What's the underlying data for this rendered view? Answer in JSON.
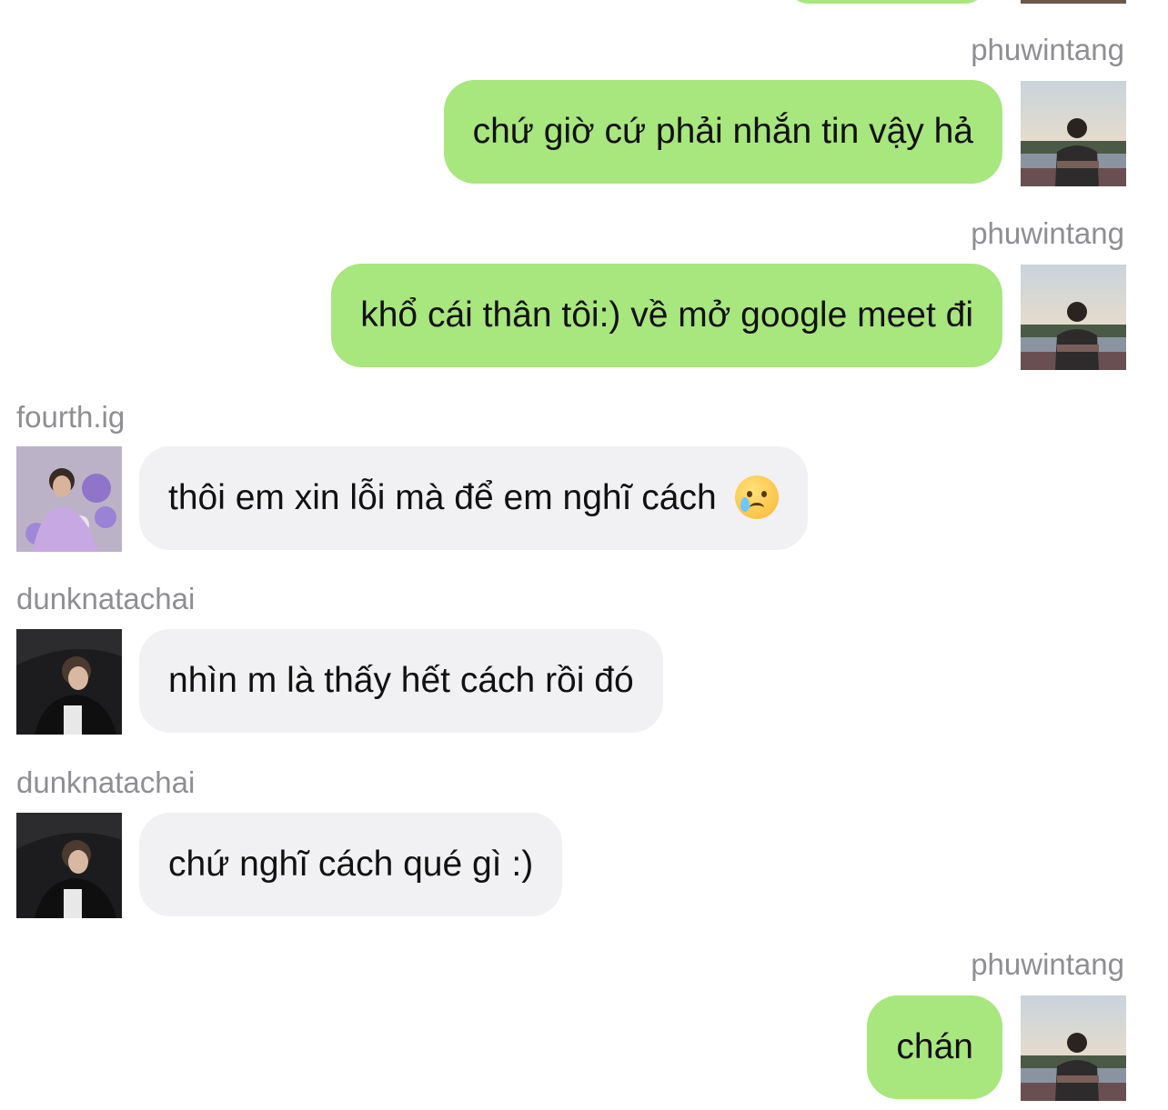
{
  "messages": [
    {
      "direction": "out",
      "sender": "phuwintang",
      "text": "chứ giờ cứ phải nhắn tin vậy hả",
      "avatar": "phuwin-avatar"
    },
    {
      "direction": "out",
      "sender": "phuwintang",
      "text": "khổ cái thân tôi:) về mở google meet đi",
      "avatar": "phuwin-avatar"
    },
    {
      "direction": "in",
      "sender": "fourth.ig",
      "text": "thôi em xin lỗi mà để em nghĩ cách",
      "emoji": "face-holding-back-tears",
      "avatar": "fourth-avatar"
    },
    {
      "direction": "in",
      "sender": "dunknatachai",
      "text": "nhìn m là thấy hết cách rồi đó",
      "avatar": "dunk-avatar"
    },
    {
      "direction": "in",
      "sender": "dunknatachai",
      "text": "chứ nghĩ cách qué gì :)",
      "avatar": "dunk-avatar"
    },
    {
      "direction": "out",
      "sender": "phuwintang",
      "text": "chán",
      "avatar": "phuwin-avatar"
    }
  ],
  "colors": {
    "outgoing_bubble": "#a8e67e",
    "incoming_bubble": "#f1f1f3",
    "sender_text": "#8e8e93"
  }
}
